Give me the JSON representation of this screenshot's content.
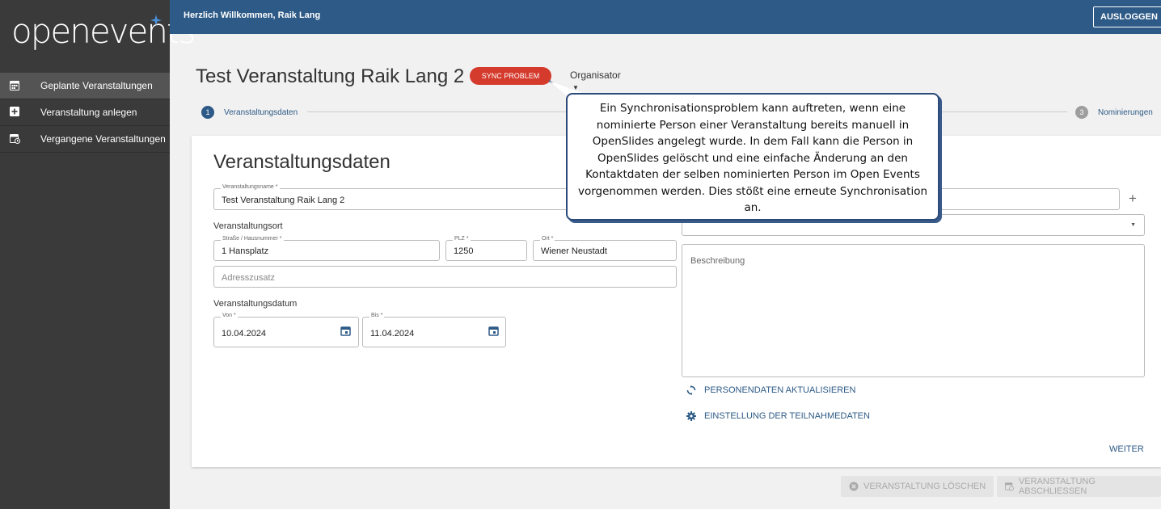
{
  "app": {
    "logo": "openevents"
  },
  "sidebar": {
    "items": [
      {
        "label": "Geplante Veranstaltungen",
        "icon": "calendar-icon",
        "active": true
      },
      {
        "label": "Veranstaltung anlegen",
        "icon": "add-box-icon",
        "active": false
      },
      {
        "label": "Vergangene Veranstaltungen",
        "icon": "calendar-history-icon",
        "active": false
      }
    ]
  },
  "topbar": {
    "welcome": "Herzlich Willkommen, Raik Lang",
    "logout_label": "AUSLOGGEN"
  },
  "header": {
    "title": "Test Veranstaltung Raik Lang 2",
    "sync_badge": "SYNC PROBLEM",
    "organizer_select": "Organisator"
  },
  "stepper": {
    "steps": [
      {
        "number": "1",
        "label": "Veranstaltungsdaten"
      },
      {
        "number": "3",
        "label": "Nominierungen"
      }
    ]
  },
  "form": {
    "title": "Veranstaltungsdaten",
    "event_name": {
      "label": "Veranstaltungsname *",
      "value": "Test Veranstaltung Raik Lang 2"
    },
    "location_section": "Veranstaltungsort",
    "street": {
      "label": "Straße / Hausnummer *",
      "value": "1 Hansplatz"
    },
    "zip": {
      "label": "PLZ *",
      "value": "1250"
    },
    "city": {
      "label": "Ort *",
      "value": "Wiener Neustadt"
    },
    "address_extra": {
      "placeholder": "Adresszusatz"
    },
    "date_section": "Veranstaltungsdatum",
    "date_from": {
      "label": "Von *",
      "value": "10.04.2024"
    },
    "date_to": {
      "label": "Bis *",
      "value": "11.04.2024"
    },
    "description": {
      "placeholder": "Beschreibung"
    },
    "update_person_data": "PERSONENDATEN AKTUALISIEREN",
    "participation_settings": "EINSTELLUNG DER TEILNAHMEDATEN",
    "next": "WEITER"
  },
  "footer_actions": {
    "delete": "VERANSTALTUNG LÖSCHEN",
    "close": "VERANSTALTUNG ABSCHLIESSEN"
  },
  "tooltip": {
    "text": "Ein Synchronisationsproblem kann auftreten, wenn eine nominierte Person einer Veranstaltung bereits manuell in OpenSlides angelegt wurde. In dem Fall kann die Person in OpenSlides gelöscht und eine einfache Änderung an den Kontaktdaten der selben nominierten Person im Open Events vorgenommen werden. Dies stößt eine erneute Synchronisation an."
  },
  "colors": {
    "primary": "#2d5a86",
    "sidebar": "#3a3a3a",
    "alert": "#d43b2d",
    "logo_accent": "#4a90d9"
  }
}
